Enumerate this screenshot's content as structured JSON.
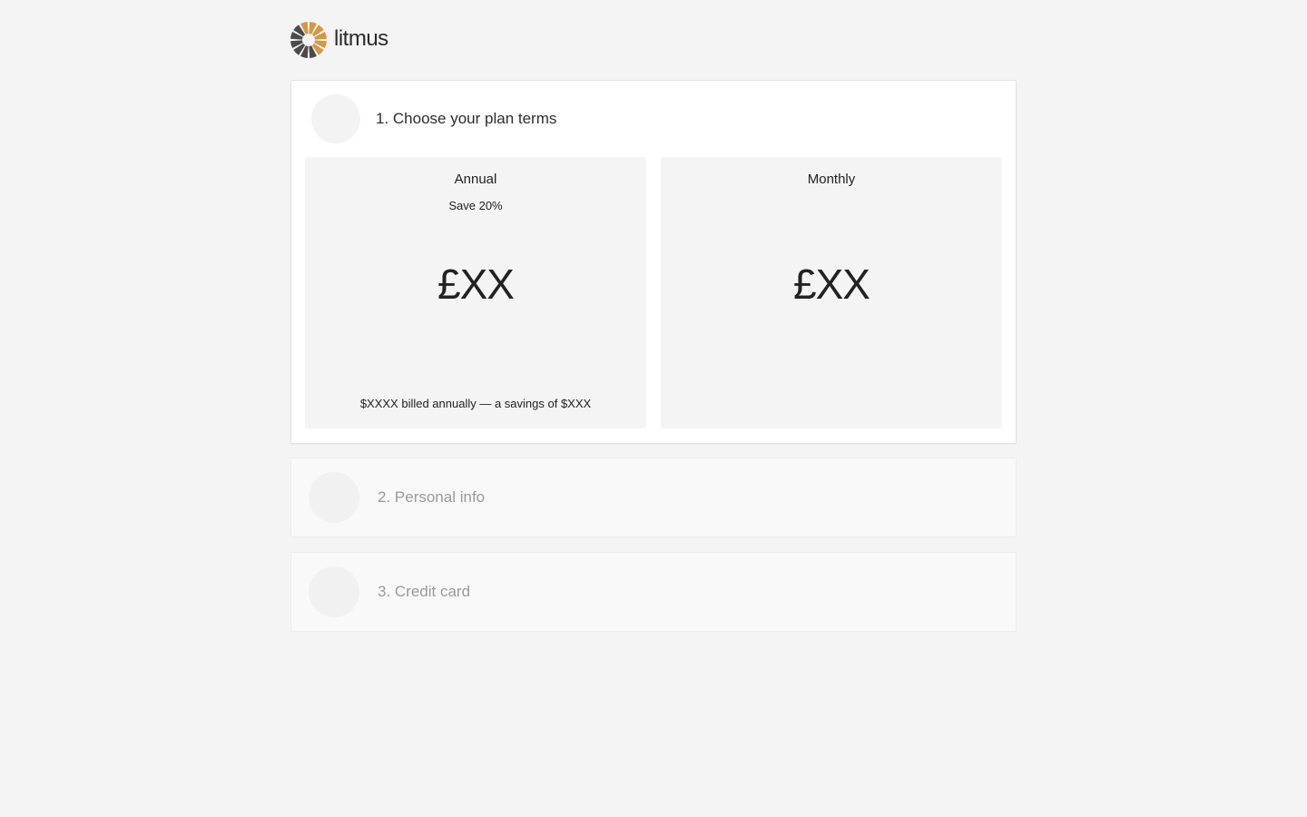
{
  "brand": {
    "name": "litmus",
    "logo_icon": "litmus-sunburst-logo",
    "colors": {
      "gold": "#d29a45",
      "dark": "#4a4a4a",
      "background": "#f4f4f4"
    }
  },
  "steps": [
    {
      "title": "1. Choose your plan terms",
      "state": "active",
      "plans": [
        {
          "name": "Annual",
          "note": "Save 20%",
          "price": "£XX",
          "footer": "$XXXX billed annually — a savings of $XXX"
        },
        {
          "name": "Monthly",
          "note": "",
          "price": "£XX",
          "footer": ""
        }
      ]
    },
    {
      "title": "2. Personal info",
      "state": "inactive"
    },
    {
      "title": "3. Credit card",
      "state": "inactive"
    }
  ]
}
